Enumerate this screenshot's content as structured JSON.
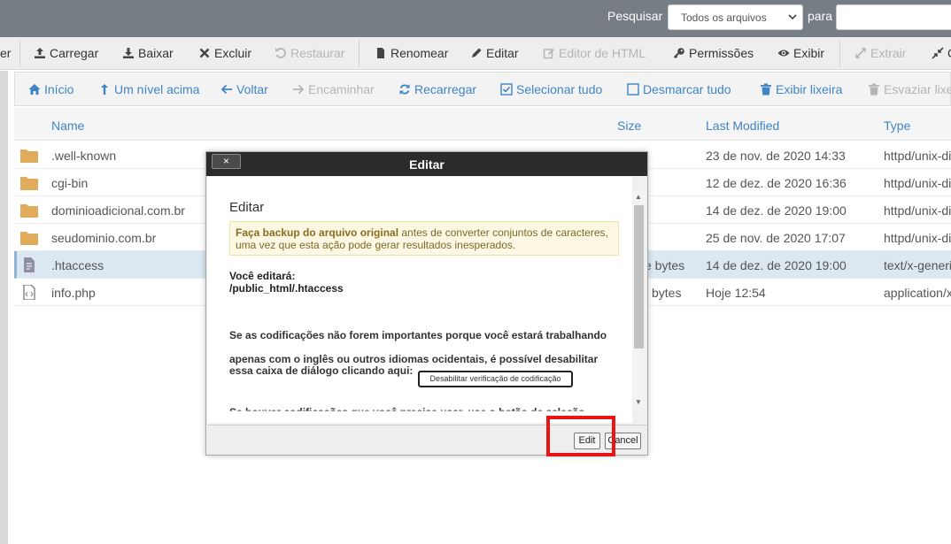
{
  "search": {
    "label_search": "Pesquisar",
    "scope_value": "Todos os arquivos",
    "label_for": "para"
  },
  "toolbar": {
    "items": [
      {
        "label": "er",
        "disabled": false
      },
      {
        "label": "Carregar",
        "icon": "upload-icon",
        "disabled": false
      },
      {
        "label": "Baixar",
        "icon": "download-icon",
        "disabled": false
      },
      {
        "label": "Excluir",
        "icon": "close-icon",
        "disabled": false
      },
      {
        "label": "Restaurar",
        "icon": "undo-icon",
        "disabled": true
      },
      {
        "label": "Renomear",
        "icon": "file-icon",
        "disabled": false
      },
      {
        "label": "Editar",
        "icon": "pencil-icon",
        "disabled": false
      },
      {
        "label": "Editor de HTML",
        "icon": "edit-square-icon",
        "disabled": true
      },
      {
        "label": "Permissões",
        "icon": "key-icon",
        "disabled": false
      },
      {
        "label": "Exibir",
        "icon": "eye-icon",
        "disabled": false
      },
      {
        "label": "Extrair",
        "icon": "expand-icon",
        "disabled": true
      },
      {
        "label": "C",
        "icon": "compress-icon",
        "disabled": false
      }
    ]
  },
  "toolbar2": {
    "items": [
      {
        "label": "Início",
        "icon": "home-icon",
        "disabled": false
      },
      {
        "label": "Um nível acima",
        "icon": "level-up-icon",
        "disabled": false
      },
      {
        "label": "Voltar",
        "icon": "arrow-left-icon",
        "disabled": false
      },
      {
        "label": "Encaminhar",
        "icon": "arrow-right-icon",
        "disabled": true
      },
      {
        "label": "Recarregar",
        "icon": "refresh-icon",
        "disabled": false
      },
      {
        "label": "Selecionar tudo",
        "icon": "checkbox-checked-icon",
        "disabled": false
      },
      {
        "label": "Desmarcar tudo",
        "icon": "checkbox-empty-icon",
        "disabled": false
      },
      {
        "label": "Exibir lixeira",
        "icon": "trash-icon",
        "disabled": false
      },
      {
        "label": "Esvaziar lixe",
        "icon": "trash-icon",
        "disabled": true
      }
    ]
  },
  "table": {
    "headers": {
      "name": "Name",
      "size": "Size",
      "modified": "Last Modified",
      "type": "Type"
    },
    "rows": [
      {
        "name": ".well-known",
        "size": "",
        "modified": "23 de nov. de 2020 14:33",
        "type": "httpd/unix-di",
        "kind": "folder"
      },
      {
        "name": "cgi-bin",
        "size": "",
        "modified": "12 de dez. de 2020 16:36",
        "type": "httpd/unix-di",
        "kind": "folder"
      },
      {
        "name": "dominioadicional.com.br",
        "size": "",
        "modified": "14 de dez. de 2020 19:00",
        "type": "httpd/unix-di",
        "kind": "folder"
      },
      {
        "name": "seudominio.com.br",
        "size": "",
        "modified": "25 de nov. de 2020 17:07",
        "type": "httpd/unix-di",
        "kind": "folder"
      },
      {
        "name": ".htaccess",
        "size": "e bytes",
        "modified": "14 de dez. de 2020 19:00",
        "type": "text/x-generi",
        "kind": "doc"
      },
      {
        "name": "info.php",
        "size": "bytes",
        "modified": "Hoje 12:54",
        "type": "application/x",
        "kind": "code"
      }
    ]
  },
  "dialog": {
    "title": "Editar",
    "close_label": "×",
    "heading": "Editar",
    "warning_bold": "Faça backup do arquivo original",
    "warning_rest": " antes de converter conjuntos de caracteres, uma vez que esta ação pode gerar resultados inesperados.",
    "edit_label": "Você editará:",
    "edit_path": "/public_html/.htaccess",
    "paragraph": "Se as codificações não forem importantes porque você estará trabalhando apenas com o inglês ou outros idiomas ocidentais, é possível desabilitar",
    "paragraph_end": "essa caixa de diálogo clicando aqui:",
    "disable_button": "Desabilitar verificação de codificação",
    "cut_text": "Se houver codificações que você precise usar, use o botão de seleção",
    "edit_button": "Edit",
    "cancel_button": "Cancel"
  },
  "colors": {
    "accent": "#3f84c4",
    "highlight": "#e81416",
    "topbar": "#767d85"
  }
}
